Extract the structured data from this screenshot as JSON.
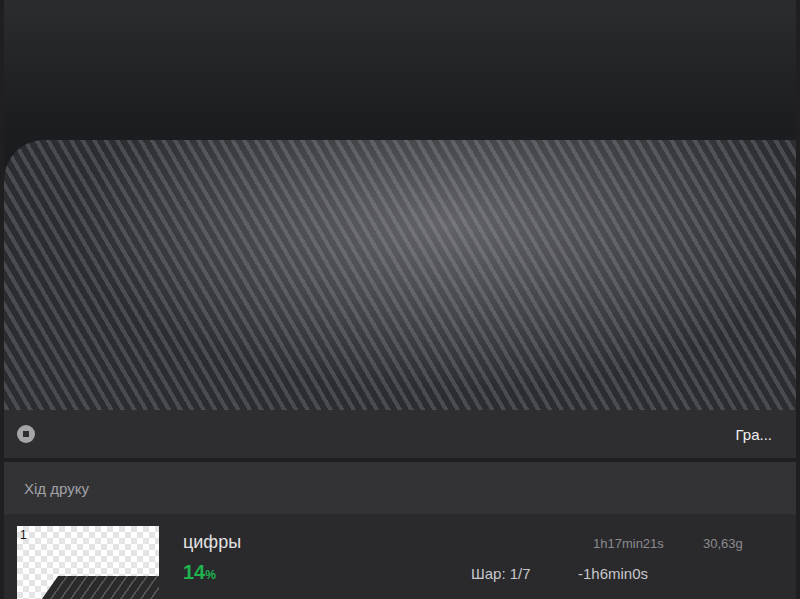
{
  "camera_bar": {
    "right_label": "Гра..."
  },
  "section": {
    "title": "Хід друку"
  },
  "task": {
    "plate_number": "1",
    "name": "цифры",
    "progress": "14",
    "progress_unit": "%",
    "total_time": "1h17min21s",
    "weight": "30,63g",
    "layer": "Шар: 1/7",
    "remaining": "-1h6min0s"
  }
}
